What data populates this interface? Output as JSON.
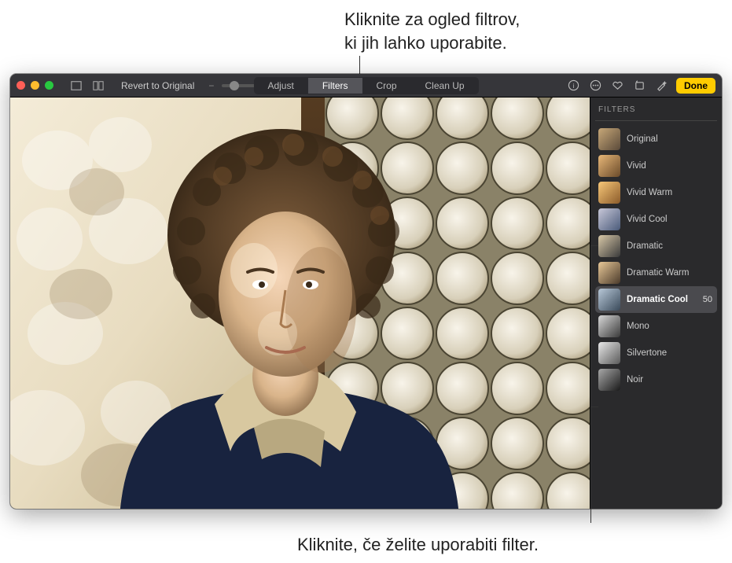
{
  "callouts": {
    "top": "Kliknite za ogled filtrov,\nki jih lahko uporabite.",
    "bottom": "Kliknite, če želite uporabiti filter."
  },
  "toolbar": {
    "revert": "Revert to Original",
    "tabs": {
      "adjust": "Adjust",
      "filters": "Filters",
      "crop": "Crop",
      "cleanup": "Clean Up"
    },
    "done": "Done"
  },
  "sidebar": {
    "title": "FILTERS",
    "filters": [
      {
        "label": "Original",
        "selected": false
      },
      {
        "label": "Vivid",
        "selected": false
      },
      {
        "label": "Vivid Warm",
        "selected": false
      },
      {
        "label": "Vivid Cool",
        "selected": false
      },
      {
        "label": "Dramatic",
        "selected": false
      },
      {
        "label": "Dramatic Warm",
        "selected": false
      },
      {
        "label": "Dramatic Cool",
        "selected": true,
        "value": "50"
      },
      {
        "label": "Mono",
        "selected": false
      },
      {
        "label": "Silvertone",
        "selected": false
      },
      {
        "label": "Noir",
        "selected": false
      }
    ]
  }
}
